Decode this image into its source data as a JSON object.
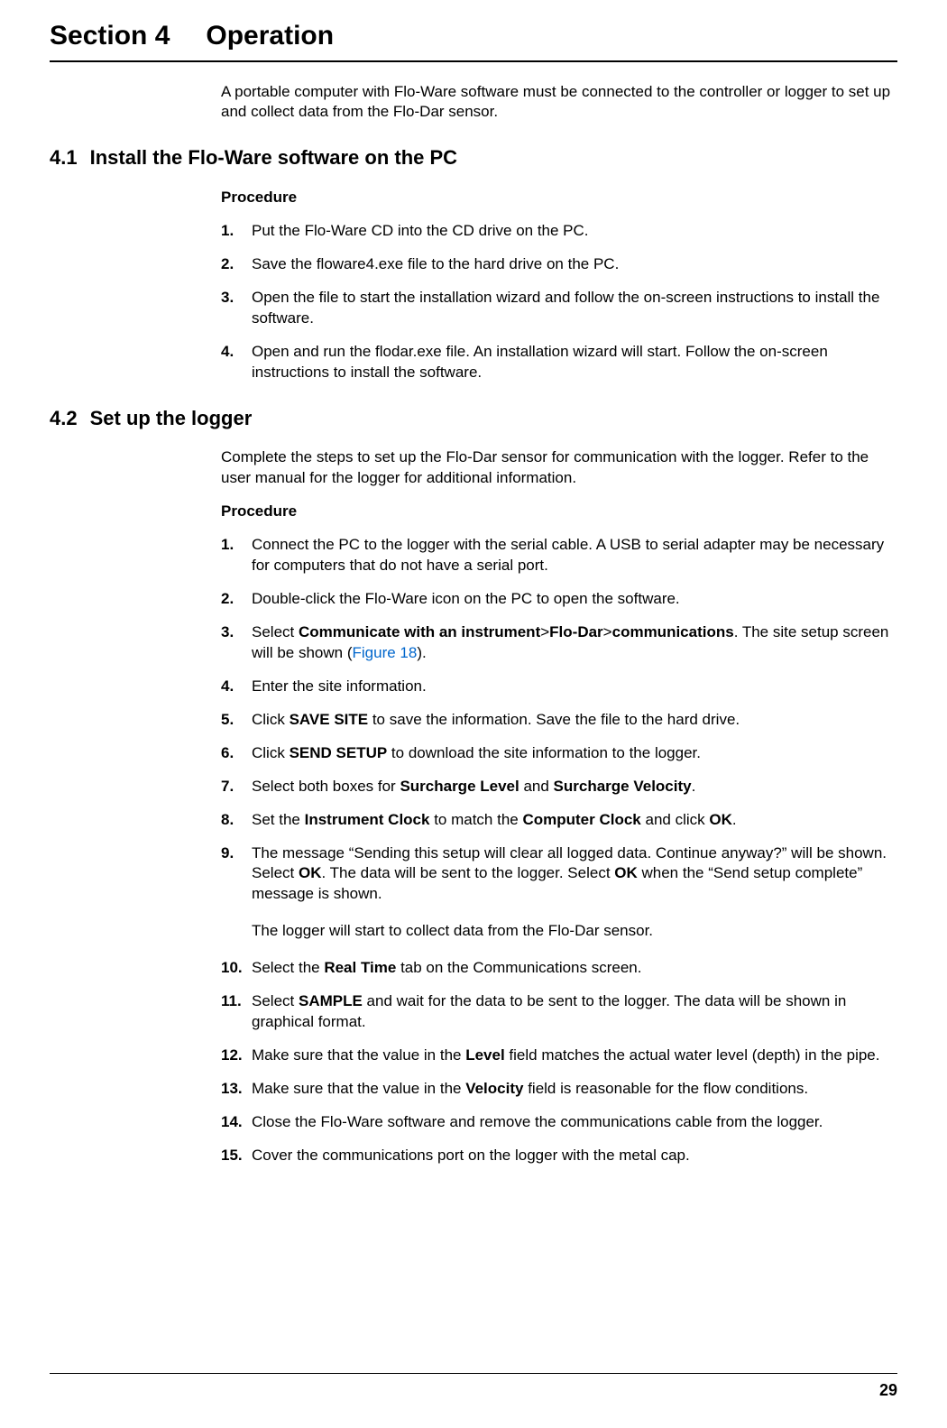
{
  "sectionNumber": "Section 4",
  "sectionTitle": "Operation",
  "intro": "A portable computer with Flo-Ware software must be connected to the controller or logger to set up and collect data from the Flo-Dar sensor.",
  "sub41": {
    "num": "4.1",
    "title": "Install the Flo-Ware software on the PC",
    "procLabel": "Procedure",
    "steps": [
      "Put the Flo-Ware CD into the CD drive on the PC.",
      "Save the floware4.exe file to the hard drive on the PC.",
      "Open the file to start the installation wizard and follow the on-screen instructions to install the software.",
      "Open and run the flodar.exe file. An installation wizard will start. Follow the on-screen instructions to install the software."
    ]
  },
  "sub42": {
    "num": "4.2",
    "title": "Set up the logger",
    "intro": "Complete the steps to set up the Flo-Dar sensor for communication with the logger. Refer to the user manual for the logger for additional information.",
    "procLabel": "Procedure",
    "step1": "Connect the PC to the logger with the serial cable. A USB to serial adapter may be necessary for computers that do not have a serial port.",
    "step2": "Double-click the Flo-Ware icon on the PC to open the software.",
    "step3_a": "Select ",
    "step3_b1": "Communicate with an instrument",
    "step3_gt1": ">",
    "step3_b2": "Flo-Dar",
    "step3_gt2": ">",
    "step3_b3": "communications",
    "step3_c": ". The site setup screen will be shown (",
    "step3_link": "Figure 18",
    "step3_d": ").",
    "step4": "Enter the site information.",
    "step5_a": "Click ",
    "step5_b": "SAVE SITE",
    "step5_c": " to save the information. Save the file to the hard drive.",
    "step6_a": "Click ",
    "step6_b": "SEND SETUP",
    "step6_c": " to download the site information to the logger.",
    "step7_a": "Select both boxes for ",
    "step7_b1": "Surcharge Level",
    "step7_mid": " and ",
    "step7_b2": "Surcharge Velocity",
    "step7_c": ".",
    "step8_a": "Set the ",
    "step8_b1": "Instrument Clock",
    "step8_mid": " to match the ",
    "step8_b2": "Computer Clock",
    "step8_c": " and click ",
    "step8_b3": "OK",
    "step8_d": ".",
    "step9_a": "The message “Sending this setup will clear all logged data. Continue anyway?” will be shown. Select ",
    "step9_b1": "OK",
    "step9_mid": ". The data will be sent to the logger. Select ",
    "step9_b2": "OK",
    "step9_c": " when the “Send setup complete” message is shown.",
    "midPara": "The logger will start to collect data from the Flo-Dar sensor.",
    "step10_a": "Select the ",
    "step10_b": "Real Time",
    "step10_c": " tab on the Communications screen.",
    "step11_a": "Select ",
    "step11_b": "SAMPLE",
    "step11_c": " and wait for the data to be sent to the logger. The data will be shown in graphical format.",
    "step12_a": "Make sure that the value in the ",
    "step12_b": "Level",
    "step12_c": " field matches the actual water level (depth) in the pipe.",
    "step13_a": "Make sure that the value in the ",
    "step13_b": "Velocity",
    "step13_c": " field is reasonable for the flow conditions.",
    "step14": "Close the Flo-Ware software and remove the communications cable from the logger.",
    "step15": "Cover the communications port on the logger with the metal cap."
  },
  "pageNumber": "29"
}
